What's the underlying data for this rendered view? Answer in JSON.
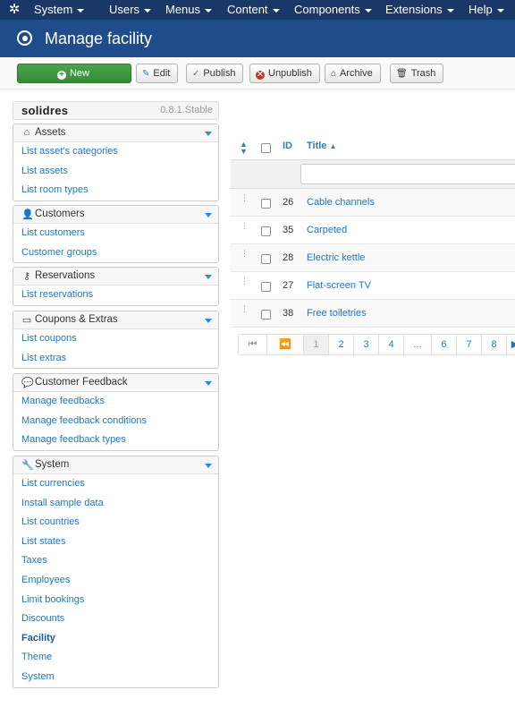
{
  "topnav": {
    "logo_icon": "joomla-logo-icon",
    "menus": [
      "System",
      "Users",
      "Menus",
      "Content",
      "Components",
      "Extensions",
      "Help"
    ]
  },
  "subhead": {
    "title": "Manage facility",
    "icon": "circle-target-icon"
  },
  "toolbar": {
    "new_label": "New",
    "edit_label": "Edit",
    "publish_label": "Publish",
    "unpublish_label": "Unpublish",
    "archive_label": "Archive",
    "trash_label": "Trash"
  },
  "brand": {
    "logo_text": "solidres",
    "version": "0.8.1.Stable"
  },
  "sidebar": {
    "panels": [
      {
        "title": "Assets",
        "icon": "home-icon",
        "items": [
          "List asset's categories",
          "List assets",
          "List room types"
        ]
      },
      {
        "title": "Customers",
        "icon": "user-icon",
        "items": [
          "List customers",
          "Customer groups"
        ]
      },
      {
        "title": "Reservations",
        "icon": "key-icon",
        "items": [
          "List reservations"
        ]
      },
      {
        "title": "Coupons & Extras",
        "icon": "document-icon",
        "items": [
          "List coupons",
          "List extras"
        ]
      },
      {
        "title": "Customer Feedback",
        "icon": "comments-icon",
        "items": [
          "Manage feedbacks",
          "Manage feedback conditions",
          "Manage feedback types"
        ]
      },
      {
        "title": "System",
        "icon": "wrench-icon",
        "items": [
          "List currencies",
          "Install sample data",
          "List countries",
          "List states",
          "Taxes",
          "Employees",
          "Limit bookings",
          "Discounts",
          "Facility",
          "Theme",
          "System"
        ]
      }
    ],
    "active_item": "Facility"
  },
  "table": {
    "headers": {
      "id": "ID",
      "title": "Title"
    },
    "filter_value": "",
    "rows": [
      {
        "id": "26",
        "title": "Cable channels"
      },
      {
        "id": "35",
        "title": "Carpeted"
      },
      {
        "id": "28",
        "title": "Electric kettle"
      },
      {
        "id": "27",
        "title": "Flat-screen TV"
      },
      {
        "id": "38",
        "title": "Free toiletries"
      }
    ]
  },
  "pagination": {
    "start_icon": "⏮",
    "prev_icon": "⏪",
    "pages": [
      "1",
      "2",
      "3",
      "4",
      "...",
      "6",
      "7",
      "8"
    ],
    "current": "1",
    "next_icon": "▶"
  }
}
